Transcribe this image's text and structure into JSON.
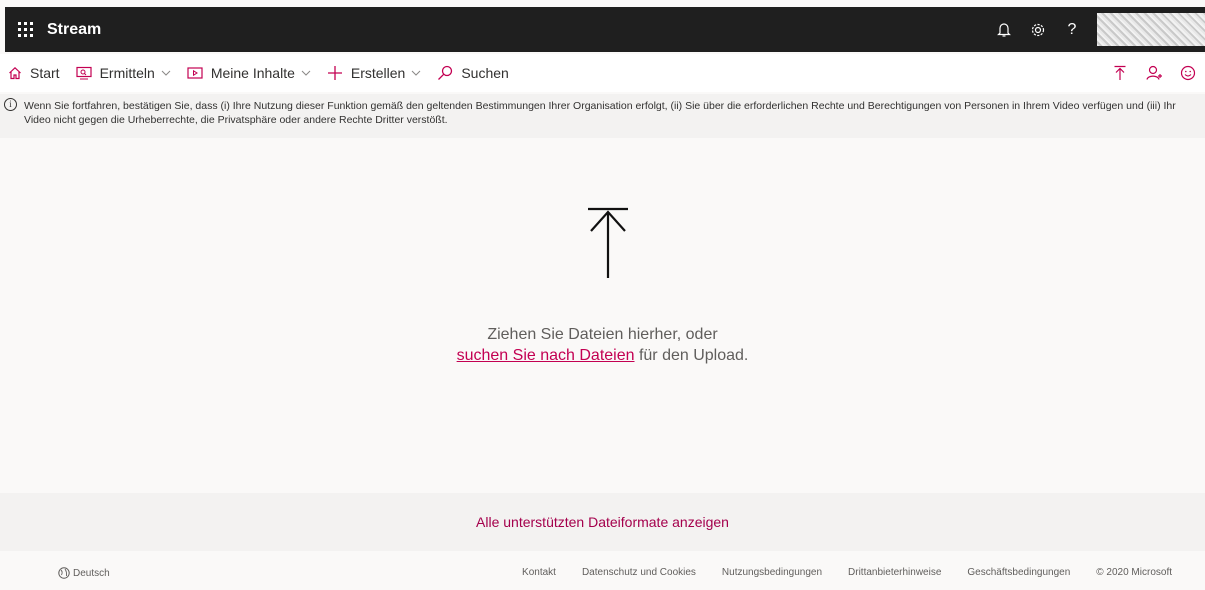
{
  "topbar": {
    "app_title": "Stream",
    "icons": [
      "waffle-icon",
      "bell-icon",
      "gear-icon",
      "help-icon"
    ],
    "help_glyph": "?"
  },
  "nav": {
    "start": "Start",
    "discover": "Ermitteln",
    "my_content": "Meine Inhalte",
    "create": "Erstellen",
    "search": "Suchen"
  },
  "notice": {
    "text": "Wenn Sie fortfahren, bestätigen Sie, dass (i) Ihre Nutzung dieser Funktion gemäß den geltenden Bestimmungen Ihrer Organisation erfolgt, (ii) Sie über die erforderlichen Rechte und Berechtigungen von Personen in Ihrem Video verfügen und (iii) Ihr Video nicht gegen die Urheberrechte, die Privatsphäre oder andere Rechte Dritter verstößt."
  },
  "dropzone": {
    "line1": "Ziehen Sie Dateien hierher, oder",
    "browse_link": "suchen Sie nach Dateien",
    "line2_rest": " für den Upload."
  },
  "formats_link": "Alle unterstützten Dateiformate anzeigen",
  "footer": {
    "language": "Deutsch",
    "links": [
      "Kontakt",
      "Datenschutz und Cookies",
      "Nutzungsbedingungen",
      "Drittanbieterhinweise",
      "Geschäftsbedingungen"
    ],
    "copyright": "© 2020 Microsoft"
  },
  "colors": {
    "accent": "#c30052",
    "topbar": "#1f1f1f",
    "background": "#faf9f8"
  }
}
